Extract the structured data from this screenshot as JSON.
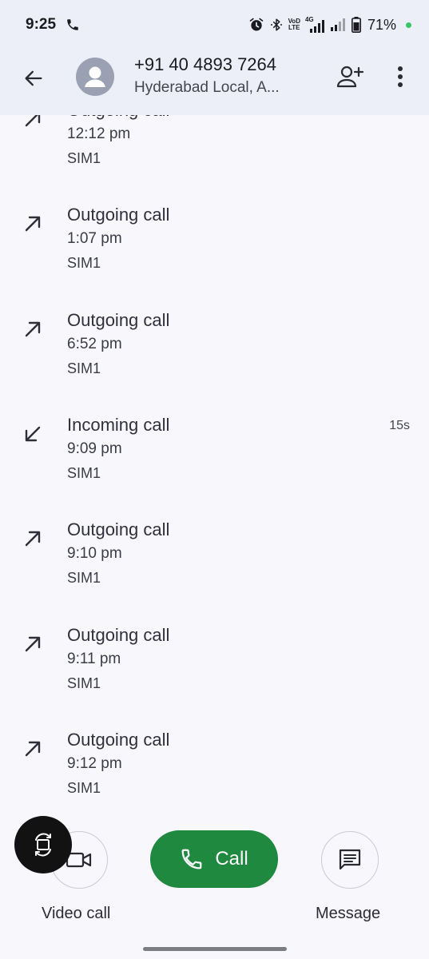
{
  "status_bar": {
    "time": "9:25",
    "network_label_top": "VoD",
    "network_label_bottom": "LTE",
    "network_4g": "4G",
    "battery": "71%"
  },
  "header": {
    "number": "+91 40 4893 7264",
    "location": "Hyderabad Local, A..."
  },
  "calls": [
    {
      "type": "Outgoing call",
      "time": "12:12 pm",
      "sim": "SIM1",
      "direction": "outgoing",
      "duration": ""
    },
    {
      "type": "Outgoing call",
      "time": "1:07 pm",
      "sim": "SIM1",
      "direction": "outgoing",
      "duration": ""
    },
    {
      "type": "Outgoing call",
      "time": "6:52 pm",
      "sim": "SIM1",
      "direction": "outgoing",
      "duration": ""
    },
    {
      "type": "Incoming call",
      "time": "9:09 pm",
      "sim": "SIM1",
      "direction": "incoming",
      "duration": "15s"
    },
    {
      "type": "Outgoing call",
      "time": "9:10 pm",
      "sim": "SIM1",
      "direction": "outgoing",
      "duration": ""
    },
    {
      "type": "Outgoing call",
      "time": "9:11 pm",
      "sim": "SIM1",
      "direction": "outgoing",
      "duration": ""
    },
    {
      "type": "Outgoing call",
      "time": "9:12 pm",
      "sim": "SIM1",
      "direction": "outgoing",
      "duration": ""
    }
  ],
  "actions": {
    "video_label": "Video call",
    "call_label": "Call",
    "message_label": "Message"
  },
  "colors": {
    "call_green": "#1f8a3f",
    "header_bg": "#eceff7",
    "page_bg": "#f8f7fc"
  }
}
